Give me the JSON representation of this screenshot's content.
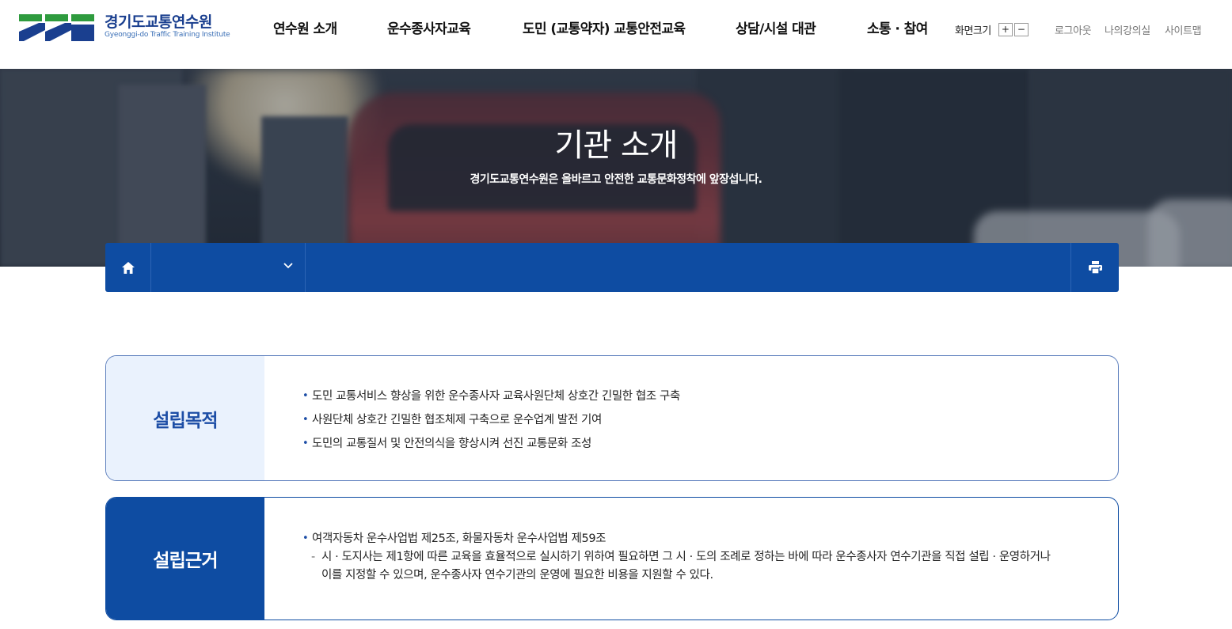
{
  "header": {
    "logo": {
      "name": "경기도교통연수원",
      "sub": "Gyeonggi-do Traffic Training Institute",
      "icon": "logo-mark",
      "colors": {
        "blue": "#1a3f8f",
        "green": "#2e9b3e"
      }
    },
    "nav": [
      {
        "label": "연수원 소개"
      },
      {
        "label": "운수종사자교육"
      },
      {
        "label": "도민 (교통약자) 교통안전교육"
      },
      {
        "label": "상담/시설 대관"
      },
      {
        "label": "소통 · 참여"
      }
    ],
    "fontsize": {
      "label": "화면크기",
      "plus": "+",
      "minus": "−"
    },
    "util": {
      "logout": "로그아웃",
      "my_classroom": "나의강의실",
      "sitemap": "사이트맵"
    }
  },
  "banner": {
    "title": "기관 소개",
    "subtitle": "경기도교통연수원은 올바르고 안전한 교통문화정착에 앞장섭니다."
  },
  "locbar": {
    "home_icon": "home-icon",
    "dropdown_value": "",
    "dropdown_icon": "chevron-down-icon",
    "print_icon": "print-icon",
    "color": "#0e4ca2"
  },
  "sections": [
    {
      "title": "설립목적",
      "bullets": [
        "도민 교통서비스 향상을 위한 운수종사자 교육사원단체 상호간 긴밀한 협조 구축",
        "사원단체 상호간 긴밀한 협조체제 구축으로 운수업계 발전 기여",
        "도민의 교통질서 및 안전의식을 향상시켜 선진 교통문화 조성"
      ]
    },
    {
      "title": "설립근거",
      "bullets": [
        "여객자동차 운수사업법 제25조, 화물자동차 운수사업법 제59조"
      ],
      "detail_line1": "시 · 도지사는 제1항에 따른 교육을 효율적으로 실시하기 위하여 필요하면 그 시 · 도의 조례로 정하는 바에 따라 운수종사자 연수기관을 직접 설립 · 운영하거나",
      "detail_line2": "이를 지정할 수 있으며, 운수종사자 연수기관의 운영에 필요한 비용을 지원할 수 있다."
    }
  ]
}
